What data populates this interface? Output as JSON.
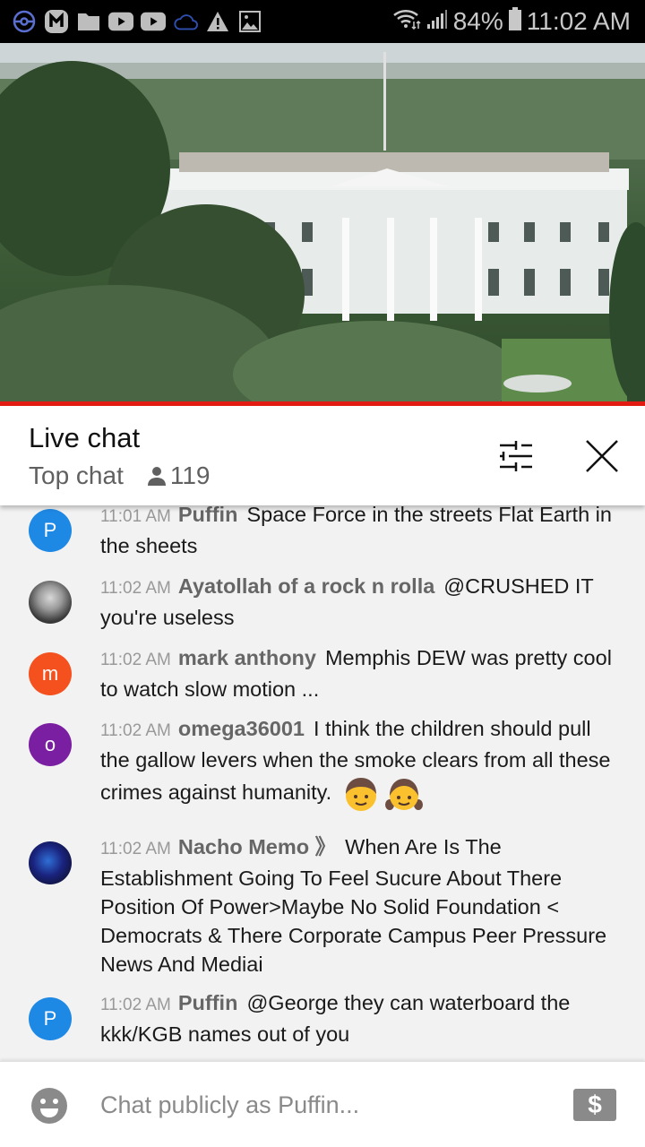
{
  "status_bar": {
    "left_icons": [
      "pokeball-icon",
      "m-app-icon",
      "folder-icon",
      "youtube-icon",
      "youtube-icon",
      "cloud-icon",
      "warning-icon",
      "image-icon"
    ],
    "battery_percent": "84%",
    "time": "11:02 AM"
  },
  "video": {
    "description": "Live stream of the White House",
    "progress_color": "#e31b12"
  },
  "chat_header": {
    "title": "Live chat",
    "mode": "Top chat",
    "viewer_count": "119"
  },
  "messages": [
    {
      "time": "11:01 AM",
      "author": "Puffin",
      "text": "Space Force in the streets Flat Earth in the sheets",
      "avatar_letter": "P",
      "avatar_color": "#1e88e5",
      "avatar_type": "letter"
    },
    {
      "time": "11:02 AM",
      "author": "Ayatollah of a rock n rolla",
      "text": "@CRUSHED IT you're useless",
      "avatar_letter": "",
      "avatar_color": "#555555",
      "avatar_type": "photo"
    },
    {
      "time": "11:02 AM",
      "author": "mark anthony",
      "text": "Memphis DEW was pretty cool to watch slow motion ...",
      "avatar_letter": "m",
      "avatar_color": "#f4511e",
      "avatar_type": "letter"
    },
    {
      "time": "11:02 AM",
      "author": "omega36001",
      "text": "I think the children should pull the gallow levers when the smoke clears from all these crimes against humanity.",
      "emojis": [
        "boy-emoji",
        "girl-emoji"
      ],
      "avatar_letter": "o",
      "avatar_color": "#7b1fa2",
      "avatar_type": "letter"
    },
    {
      "time": "11:02 AM",
      "author": "Nacho Memo 》",
      "text": "When Are Is The Establishment Going To Feel Sucure About There Position Of Power>Maybe No Solid Foundation < Democrats & There Corporate Campus Peer Pressure News And Mediai",
      "avatar_letter": "",
      "avatar_color": "#1a237e",
      "avatar_type": "photo"
    },
    {
      "time": "11:02 AM",
      "author": "Puffin",
      "text": "@George they can waterboard the kkk/KGB names out of you",
      "avatar_letter": "P",
      "avatar_color": "#1e88e5",
      "avatar_type": "letter"
    }
  ],
  "input": {
    "placeholder": "Chat publicly as Puffin...",
    "value": "",
    "super_chat_symbol": "$"
  }
}
